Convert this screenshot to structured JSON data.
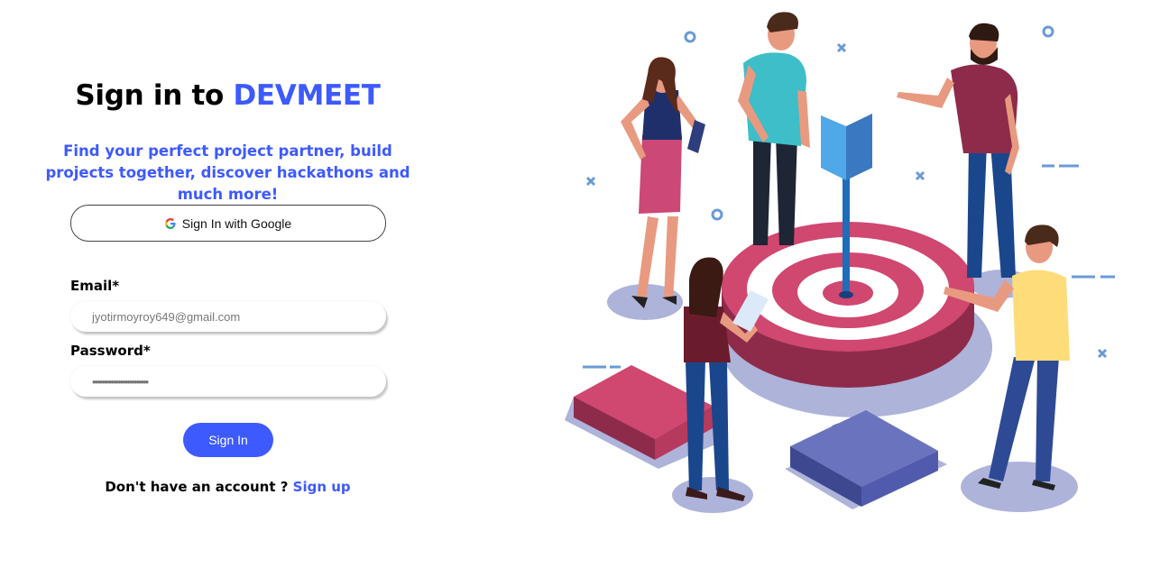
{
  "header": {
    "title_prefix": "Sign in to",
    "title_brand": "DEVMEET",
    "subtitle": "Find your perfect project partner, build projects together, discover hackathons and much more!"
  },
  "google": {
    "label": "Sign In with Google",
    "icon": "google-g-icon"
  },
  "form": {
    "email_label": "Email*",
    "email_value": "jyotirmoyroy649@gmail.com",
    "password_label": "Password*",
    "password_value": "••••••••••••••••••••••••",
    "submit_label": "Sign In"
  },
  "footer": {
    "question": "Don't have an account ?",
    "signup_label": "Sign up"
  },
  "illustration": {
    "description_icon": "team-target-illustration",
    "colors": {
      "accent": "#3d5afe",
      "target_red": "#d0476f",
      "puzzle_blue": "#5b6ab5",
      "shadow": "#b0b6dc"
    }
  }
}
